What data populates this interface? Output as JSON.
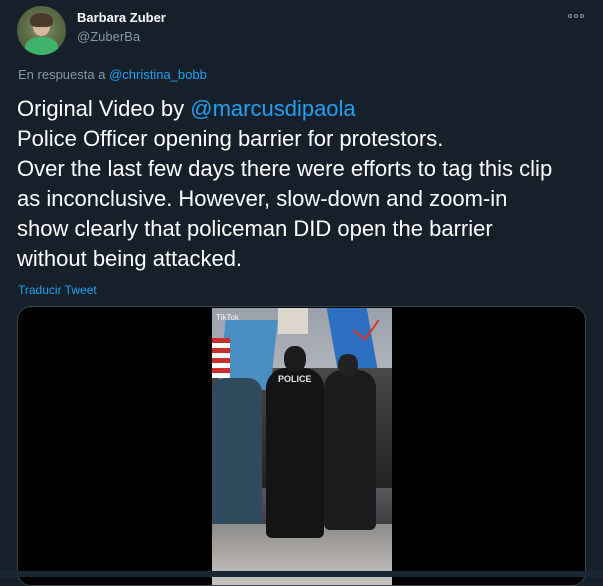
{
  "author": {
    "display_name": "Barbara Zuber",
    "handle": "@ZuberBa"
  },
  "reply": {
    "prefix": "En respuesta a",
    "mention": "@christina_bobb"
  },
  "tweet": {
    "line1_prefix": "Original Video by ",
    "line1_mention": "@marcusdipaola",
    "line2": "Police Officer opening barrier for protestors.",
    "line3": "Over the last few days there were efforts to tag this clip",
    "line4": "as inconclusive. However, slow-down and zoom-in",
    "line5": "show clearly that policeman DID open the barrier",
    "line6": "without being attacked."
  },
  "translate_label": "Traducir Tweet",
  "media": {
    "video_watermark": "TikTok",
    "vest_text": "POLICE"
  },
  "colors": {
    "background": "#15202b",
    "link": "#1da1f2",
    "secondary_text": "#8899a6"
  }
}
